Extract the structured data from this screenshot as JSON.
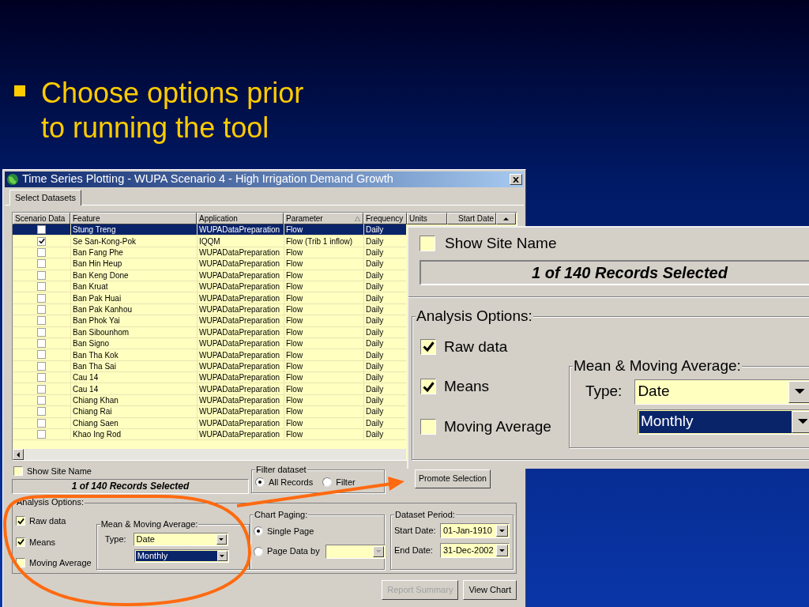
{
  "slide": {
    "bullet": "Choose options prior to running the tool"
  },
  "window": {
    "title": "Time Series Plotting - WUPA Scenario 4 - High Irrigation Demand Growth",
    "tabs": [
      {
        "label": "Select Datasets",
        "selected": true
      }
    ]
  },
  "grid": {
    "columns": [
      {
        "label": "Scenario Data",
        "sorted": false
      },
      {
        "label": "Feature",
        "sorted": false
      },
      {
        "label": "Application",
        "sorted": false
      },
      {
        "label": "Parameter",
        "sorted": true
      },
      {
        "label": "Frequency",
        "sorted": false
      },
      {
        "label": "Units",
        "sorted": false
      },
      {
        "label": "Start Date",
        "sorted": false
      }
    ],
    "rows": [
      {
        "selected": true,
        "checked": false,
        "feature": "Stung Treng",
        "application": "WUPADataPreparation",
        "parameter": "Flow",
        "frequency": "Daily"
      },
      {
        "selected": false,
        "checked": true,
        "feature": "Se San-Kong-Pok",
        "application": "IQQM",
        "parameter": "Flow (Trib 1 inflow)",
        "frequency": "Daily"
      },
      {
        "selected": false,
        "checked": false,
        "feature": "Ban Fang Phe",
        "application": "WUPADataPreparation",
        "parameter": "Flow",
        "frequency": "Daily"
      },
      {
        "selected": false,
        "checked": false,
        "feature": "Ban Hin Heup",
        "application": "WUPADataPreparation",
        "parameter": "Flow",
        "frequency": "Daily"
      },
      {
        "selected": false,
        "checked": false,
        "feature": "Ban Keng Done",
        "application": "WUPADataPreparation",
        "parameter": "Flow",
        "frequency": "Daily"
      },
      {
        "selected": false,
        "checked": false,
        "feature": "Ban Kruat",
        "application": "WUPADataPreparation",
        "parameter": "Flow",
        "frequency": "Daily"
      },
      {
        "selected": false,
        "checked": false,
        "feature": "Ban Pak Huai",
        "application": "WUPADataPreparation",
        "parameter": "Flow",
        "frequency": "Daily"
      },
      {
        "selected": false,
        "checked": false,
        "feature": "Ban Pak Kanhou",
        "application": "WUPADataPreparation",
        "parameter": "Flow",
        "frequency": "Daily"
      },
      {
        "selected": false,
        "checked": false,
        "feature": "Ban Phok Yai",
        "application": "WUPADataPreparation",
        "parameter": "Flow",
        "frequency": "Daily"
      },
      {
        "selected": false,
        "checked": false,
        "feature": "Ban Sibounhom",
        "application": "WUPADataPreparation",
        "parameter": "Flow",
        "frequency": "Daily"
      },
      {
        "selected": false,
        "checked": false,
        "feature": "Ban Signo",
        "application": "WUPADataPreparation",
        "parameter": "Flow",
        "frequency": "Daily"
      },
      {
        "selected": false,
        "checked": false,
        "feature": "Ban Tha Kok",
        "application": "WUPADataPreparation",
        "parameter": "Flow",
        "frequency": "Daily"
      },
      {
        "selected": false,
        "checked": false,
        "feature": "Ban Tha Sai",
        "application": "WUPADataPreparation",
        "parameter": "Flow",
        "frequency": "Daily"
      },
      {
        "selected": false,
        "checked": false,
        "feature": "Cau 14",
        "application": "WUPADataPreparation",
        "parameter": "Flow",
        "frequency": "Daily"
      },
      {
        "selected": false,
        "checked": false,
        "feature": "Cau 14",
        "application": "WUPADataPreparation",
        "parameter": "Flow",
        "frequency": "Daily"
      },
      {
        "selected": false,
        "checked": false,
        "feature": "Chiang Khan",
        "application": "WUPADataPreparation",
        "parameter": "Flow",
        "frequency": "Daily"
      },
      {
        "selected": false,
        "checked": false,
        "feature": "Chiang Rai",
        "application": "WUPADataPreparation",
        "parameter": "Flow",
        "frequency": "Daily"
      },
      {
        "selected": false,
        "checked": false,
        "feature": "Chiang Saen",
        "application": "WUPADataPreparation",
        "parameter": "Flow",
        "frequency": "Daily"
      },
      {
        "selected": false,
        "checked": false,
        "feature": "Khao Ing Rod",
        "application": "WUPADataPreparation",
        "parameter": "Flow",
        "frequency": "Daily"
      }
    ]
  },
  "site_name": {
    "label": "Show Site Name",
    "checked": false
  },
  "records": "1 of 140 Records Selected",
  "filter": {
    "legend": "Filter dataset",
    "options": [
      {
        "label": "All Records",
        "selected": true
      },
      {
        "label": "Filter",
        "selected": false
      }
    ]
  },
  "promote_button": "Promote Selection",
  "analysis": {
    "legend": "Analysis Options:",
    "options": [
      {
        "label": "Raw data",
        "checked": true
      },
      {
        "label": "Means",
        "checked": true
      },
      {
        "label": "Moving Average",
        "checked": false
      }
    ],
    "mma": {
      "legend": "Mean & Moving Average:",
      "type_label": "Type:",
      "type_value": "Date",
      "period_value": "Monthly"
    }
  },
  "chart_paging": {
    "legend": "Chart Paging:",
    "options": [
      {
        "label": "Single Page",
        "selected": true
      },
      {
        "label": "Page Data by",
        "selected": false
      }
    ]
  },
  "dataset_period": {
    "legend": "Dataset Period:",
    "start_label": "Start Date:",
    "start_value": "01-Jan-1910",
    "end_label": "End Date:",
    "end_value": "31-Dec-2002"
  },
  "buttons": [
    {
      "label": "Report Summary",
      "disabled": true
    },
    {
      "label": "View Chart",
      "disabled": false
    }
  ],
  "zoom_inset": {
    "site_name": {
      "label": "Show Site Name",
      "checked": false
    },
    "records": "1 of 140 Records Selected",
    "analysis": {
      "legend": "Analysis Options:",
      "options": [
        {
          "label": "Raw data",
          "checked": true
        },
        {
          "label": "Means",
          "checked": true
        },
        {
          "label": "Moving Average",
          "checked": false
        }
      ],
      "mma": {
        "legend": "Mean & Moving Average:",
        "type_label": "Type:",
        "type_value": "Date",
        "period_value": "Monthly"
      }
    }
  }
}
